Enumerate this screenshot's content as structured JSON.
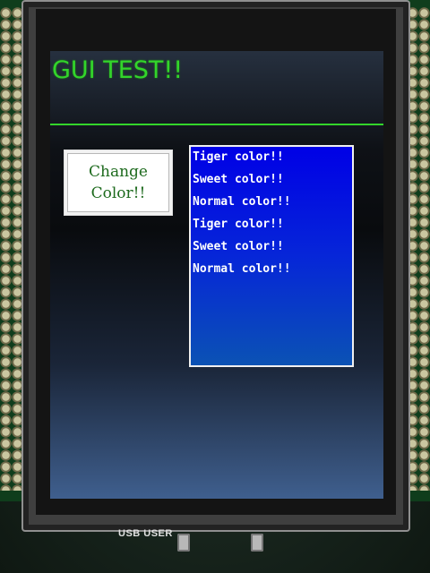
{
  "screen": {
    "title": "GUI TEST!!",
    "change_button": {
      "label": "Change\nColor!!"
    },
    "list": {
      "items": [
        "Tiger color!!",
        "Sweet color!!",
        "Normal color!!",
        "Tiger color!!",
        "Sweet color!!",
        "Normal color!!"
      ]
    }
  },
  "board": {
    "usb_label": "USB USER"
  },
  "colors": {
    "title_green": "#33d52b",
    "list_blue": "#0000e6",
    "button_text": "#1d6a1d"
  }
}
